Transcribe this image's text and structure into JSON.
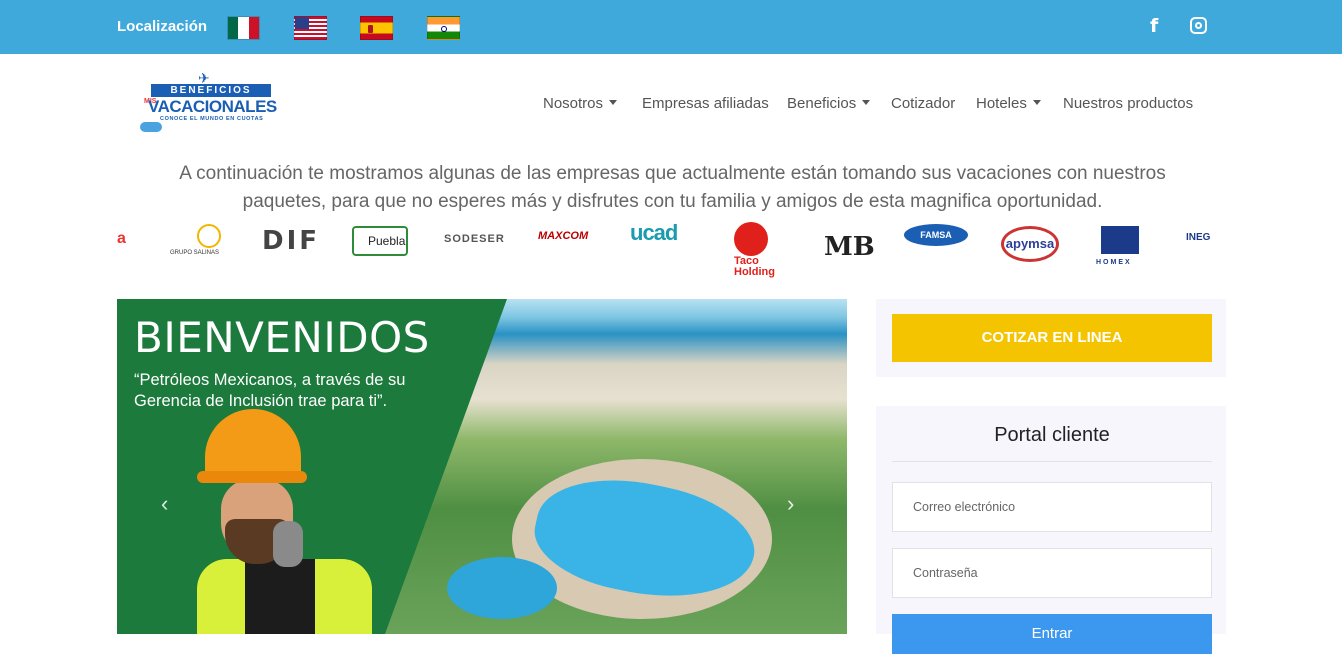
{
  "topbar": {
    "localization_label": "Localización",
    "flags": [
      {
        "name": "mexico",
        "colors": [
          "#006847",
          "#ffffff",
          "#ce1126"
        ]
      },
      {
        "name": "usa",
        "colors": [
          "#c8102e",
          "#ffffff",
          "#2a3f8a"
        ]
      },
      {
        "name": "spain",
        "colors": [
          "#c60b1e",
          "#ffc400"
        ]
      },
      {
        "name": "india",
        "colors": [
          "#ff9933",
          "#ffffff",
          "#138808"
        ]
      }
    ],
    "social": [
      {
        "name": "facebook-icon",
        "glyph": "f"
      },
      {
        "name": "instagram-icon"
      }
    ],
    "background_color": "#40a9dc"
  },
  "logo": {
    "band_text": "BENEFICIOS",
    "main_text": "VACACIONALES",
    "mis_text": "MIS",
    "tagline": "CONOCE EL MUNDO EN CUOTAS"
  },
  "nav": {
    "items": [
      {
        "label": "Nosotros",
        "dropdown": true
      },
      {
        "label": "Empresas afiliadas",
        "dropdown": false
      },
      {
        "label": "Beneficios",
        "dropdown": true
      },
      {
        "label": "Cotizador",
        "dropdown": false
      },
      {
        "label": "Hoteles",
        "dropdown": true
      },
      {
        "label": "Nuestros productos",
        "dropdown": false
      }
    ]
  },
  "intro": {
    "text": "A continuación te mostramos algunas de las empresas que actualmente están tomando sus vacaciones con nuestros paquetes, para que no esperes más y disfrutes con tu familia y amigos de esta magnifica oportunidad."
  },
  "brands": {
    "items": [
      {
        "text": "a",
        "color": "#e33"
      },
      {
        "text": "GRUPO SALINAS",
        "color": "#333"
      },
      {
        "text": "DIF",
        "color": "#444"
      },
      {
        "text": "Puebla",
        "color": "#333"
      },
      {
        "text": "SODESER",
        "color": "#555"
      },
      {
        "text": "MAXCOM",
        "color": "#b00"
      },
      {
        "text": "ucad",
        "color": "#1a9bb0"
      },
      {
        "text": "Taco Holding",
        "color": "#e0201a"
      },
      {
        "text": "MB",
        "color": "#222"
      },
      {
        "text": "FAMSA",
        "color": "#1b5fb5"
      },
      {
        "text": "apymsa",
        "color": "#2c3e99"
      },
      {
        "text": "HOMEX",
        "color": "#1b3b8a"
      },
      {
        "text": "INEG",
        "color": "#1b3b8a"
      }
    ]
  },
  "hero": {
    "title": "BIENVENIDOS",
    "quote": "“Petróleos Mexicanos, a través de su Gerencia de Inclusión trae para ti”.",
    "prev_glyph": "‹",
    "next_glyph": "›"
  },
  "sidebar": {
    "cotizar_label": "COTIZAR EN LINEA",
    "cotizar_color": "#f5c400",
    "portal_title": "Portal cliente",
    "email_placeholder": "Correo electrónico",
    "password_placeholder": "Contraseña",
    "submit_label": "Entrar",
    "submit_color": "#3b98ee"
  }
}
